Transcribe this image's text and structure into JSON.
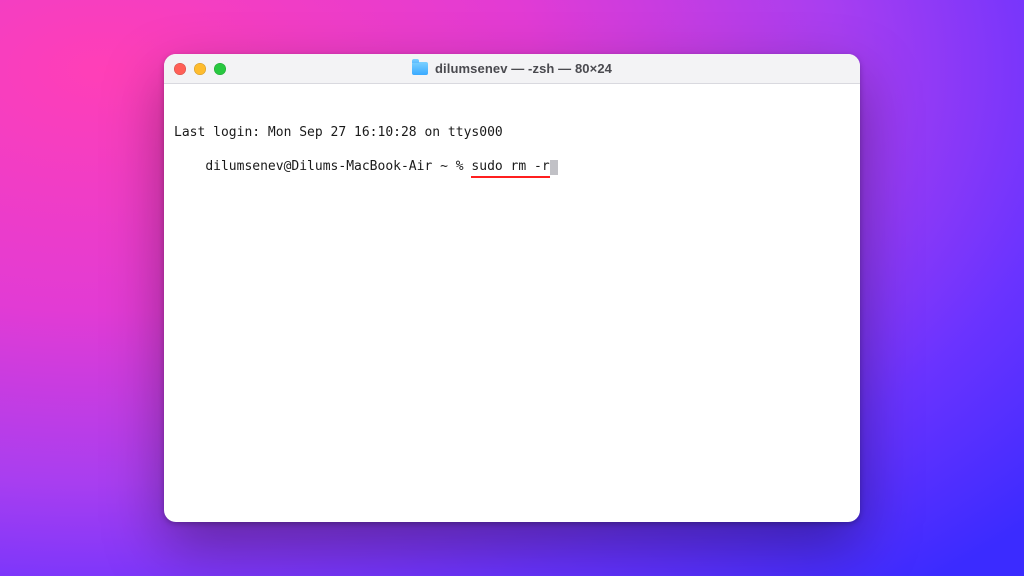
{
  "window": {
    "title": "dilumsenev — -zsh — 80×24"
  },
  "terminal": {
    "last_login": "Last login: Mon Sep 27 16:10:28 on ttys000",
    "prompt": "dilumsenev@Dilums-MacBook-Air ~ % ",
    "command": "sudo rm -r"
  }
}
